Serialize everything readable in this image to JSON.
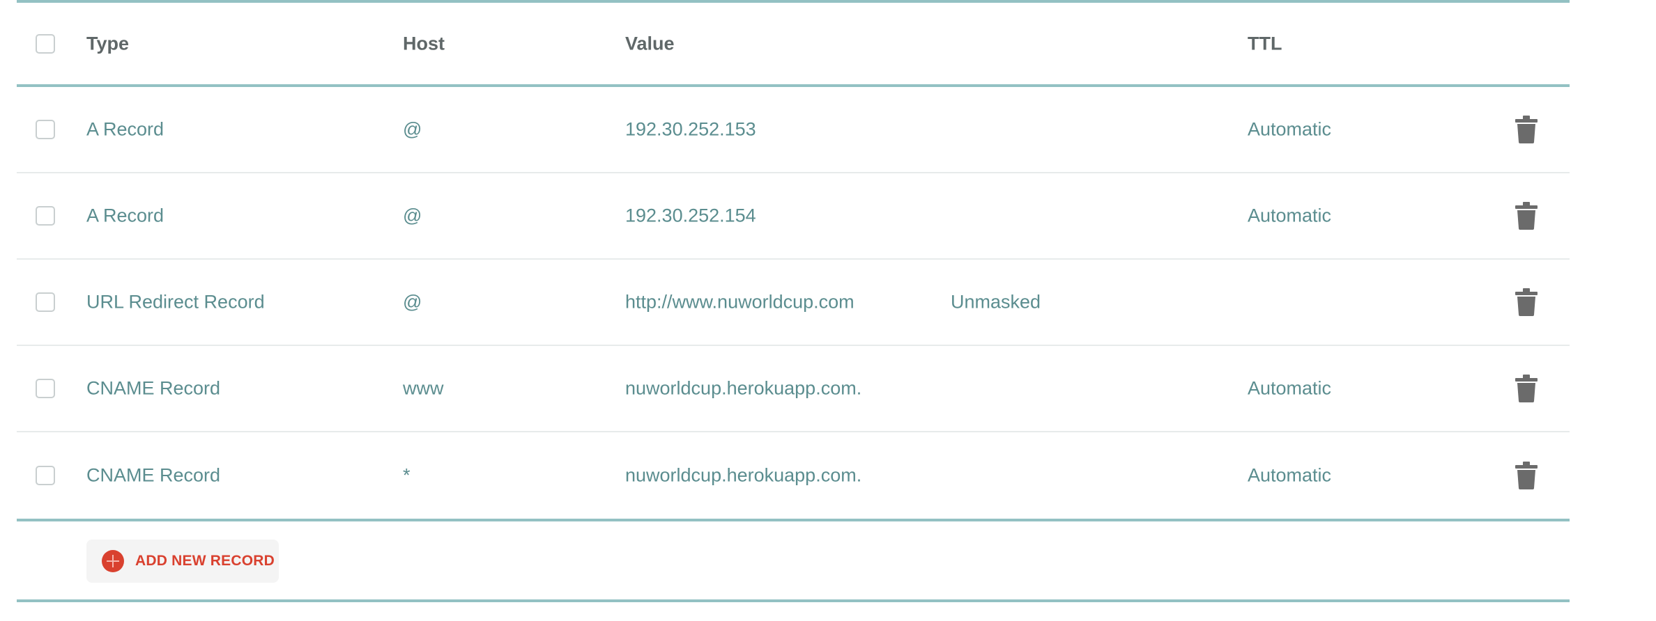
{
  "table": {
    "headers": {
      "type": "Type",
      "host": "Host",
      "value": "Value",
      "ttl": "TTL"
    },
    "records": [
      {
        "type": "A Record",
        "host": "@",
        "value": "192.30.252.153",
        "extra": "",
        "ttl": "Automatic"
      },
      {
        "type": "A Record",
        "host": "@",
        "value": "192.30.252.154",
        "extra": "",
        "ttl": "Automatic"
      },
      {
        "type": "URL Redirect Record",
        "host": "@",
        "value": "http://www.nuworldcup.com",
        "extra": "Unmasked",
        "ttl": ""
      },
      {
        "type": "CNAME Record",
        "host": "www",
        "value": "nuworldcup.herokuapp.com.",
        "extra": "",
        "ttl": "Automatic"
      },
      {
        "type": "CNAME Record",
        "host": "*",
        "value": "nuworldcup.herokuapp.com.",
        "extra": "",
        "ttl": "Automatic"
      }
    ]
  },
  "footer": {
    "add_label": "ADD NEW RECORD"
  },
  "icons": {
    "delete": "trash-icon",
    "add": "plus-circle-icon"
  },
  "colors": {
    "accent_rule": "#93c1c3",
    "data_text": "#5b8d8f",
    "header_text": "#5f6768",
    "add_accent": "#d9412f",
    "trash": "#6b6b6b"
  }
}
